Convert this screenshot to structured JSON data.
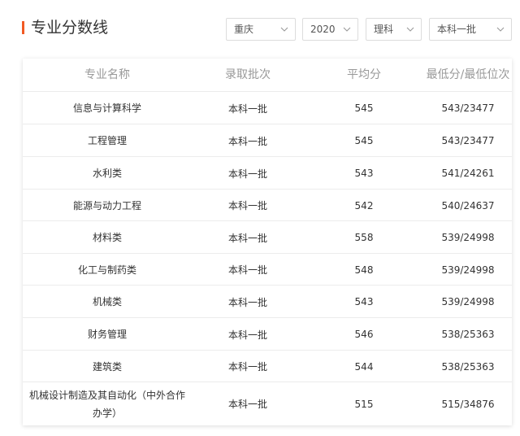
{
  "section": {
    "title": "专业分数线"
  },
  "filters": {
    "region": "重庆",
    "year": "2020",
    "subject": "理科",
    "batch": "本科一批"
  },
  "table": {
    "headers": [
      "专业名称",
      "录取批次",
      "平均分",
      "最低分/最低位次"
    ],
    "rows": [
      {
        "major": "信息与计算科学",
        "batch": "本科一批",
        "avg": "545",
        "min": "543/23477"
      },
      {
        "major": "工程管理",
        "batch": "本科一批",
        "avg": "545",
        "min": "543/23477"
      },
      {
        "major": "水利类",
        "batch": "本科一批",
        "avg": "543",
        "min": "541/24261"
      },
      {
        "major": "能源与动力工程",
        "batch": "本科一批",
        "avg": "542",
        "min": "540/24637"
      },
      {
        "major": "材料类",
        "batch": "本科一批",
        "avg": "558",
        "min": "539/24998"
      },
      {
        "major": "化工与制药类",
        "batch": "本科一批",
        "avg": "548",
        "min": "539/24998"
      },
      {
        "major": "机械类",
        "batch": "本科一批",
        "avg": "543",
        "min": "539/24998"
      },
      {
        "major": "财务管理",
        "batch": "本科一批",
        "avg": "546",
        "min": "538/25363"
      },
      {
        "major": "建筑类",
        "batch": "本科一批",
        "avg": "544",
        "min": "538/25363"
      },
      {
        "major": "机械设计制造及其自动化（中外合作办学）",
        "batch": "本科一批",
        "avg": "515",
        "min": "515/34876"
      }
    ]
  }
}
